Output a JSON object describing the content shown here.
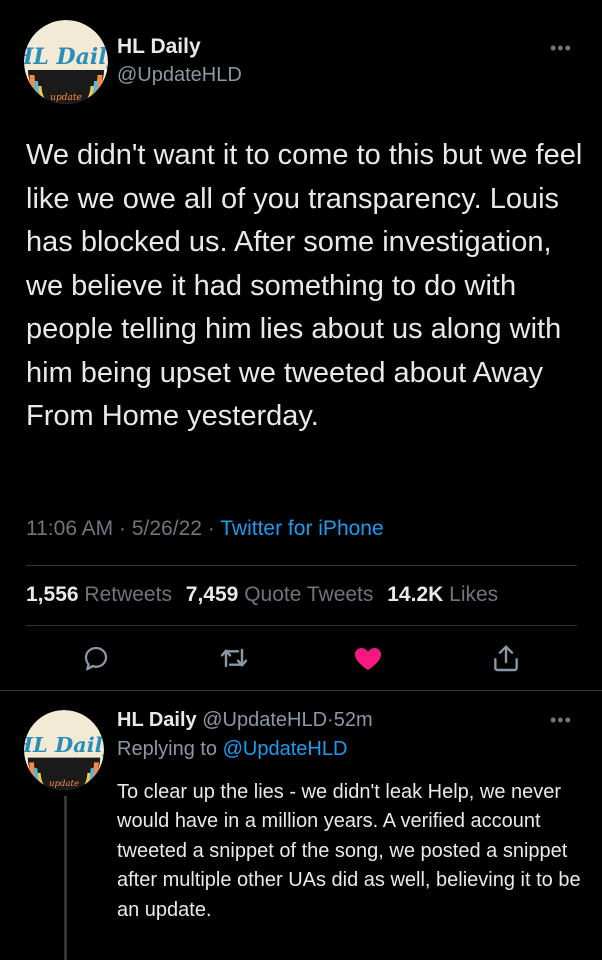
{
  "tweet": {
    "author": {
      "name": "HL Daily",
      "handle": "@UpdateHLD",
      "avatar_logo_text": "HL Daily",
      "avatar_logo_subtext": "update"
    },
    "more_label": "•••",
    "text": "We didn't want it to come to this but we feel like we owe all of you transparency. Louis has blocked us. After some investigation, we believe it had something to do with people telling him lies about us along with him being upset we tweeted about Away From Home yesterday.",
    "time": "11:06 AM",
    "sep": "·",
    "date": "5/26/22",
    "source": "Twitter for iPhone",
    "stats": {
      "retweets_count": "1,556",
      "retweets_label": "Retweets",
      "quotes_count": "7,459",
      "quotes_label": "Quote Tweets",
      "likes_count": "14.2K",
      "likes_label": "Likes"
    },
    "actions": {
      "reply_icon": "reply-icon",
      "retweet_icon": "retweet-icon",
      "like_icon": "heart-filled-icon",
      "share_icon": "share-icon",
      "liked": true
    }
  },
  "reply": {
    "author": {
      "name": "HL Daily",
      "handle": "@UpdateHLD",
      "age": "52m"
    },
    "sep": "·",
    "more_label": "•••",
    "replying_label": "Replying to",
    "replying_to": "@UpdateHLD",
    "text": "To clear up the lies - we didn't leak Help, we never would have in a million years. A verified account tweeted a snippet of the song, we posted a snippet after multiple other UAs did as well, believing it to be an update."
  },
  "colors": {
    "background": "#000000",
    "text": "#e7e9ea",
    "secondary": "#6e767d",
    "link": "#1d9bf0",
    "like": "#f91880",
    "divider": "#2f3336"
  }
}
